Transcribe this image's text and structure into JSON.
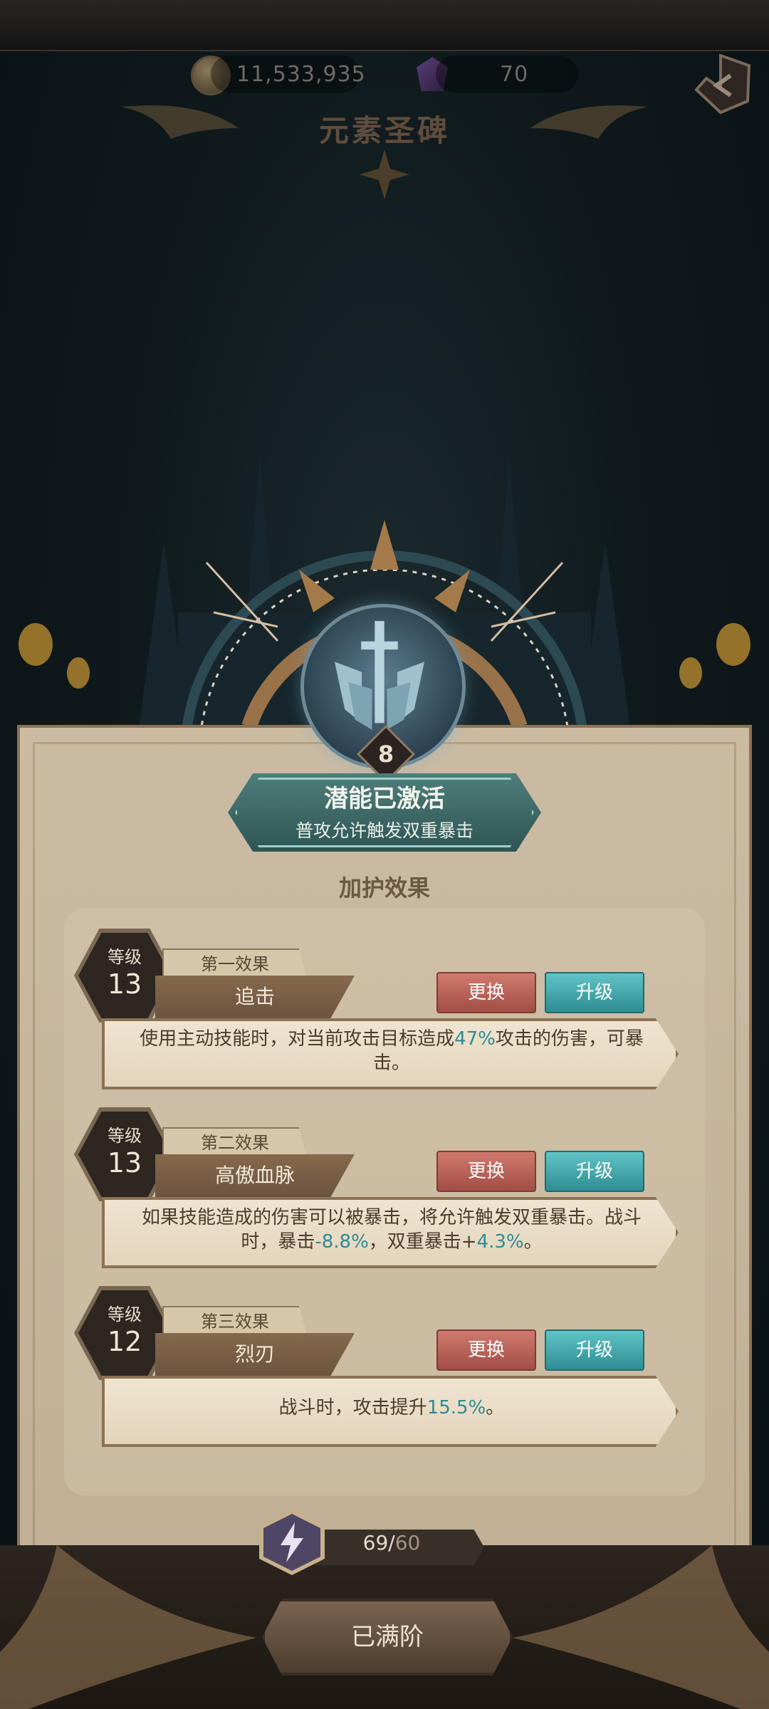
{
  "resources": {
    "gold": "11,533,935",
    "gems": "70"
  },
  "page": {
    "title": "元素圣碑"
  },
  "emblem": {
    "level": "8"
  },
  "activation": {
    "title": "潜能已激活",
    "subtitle": "普攻允许触发双重暴击"
  },
  "section": {
    "title": "加护效果"
  },
  "effects": [
    {
      "level_label": "等级",
      "level": "13",
      "slot": "第一效果",
      "name": "追击",
      "swap_label": "更换",
      "upgrade_label": "升级",
      "desc_parts": [
        "使用主动技能时，对当前攻击目标造成",
        "47%",
        "攻击的伤害，可暴击。"
      ]
    },
    {
      "level_label": "等级",
      "level": "13",
      "slot": "第二效果",
      "name": "高傲血脉",
      "swap_label": "更换",
      "upgrade_label": "升级",
      "desc_parts": [
        "如果技能造成的伤害可以被暴击，将允许触发双重暴击。战斗时，暴击",
        "-8.8%",
        "，双重暴击+",
        "4.3%",
        "。"
      ]
    },
    {
      "level_label": "等级",
      "level": "12",
      "slot": "第三效果",
      "name": "烈刃",
      "swap_label": "更换",
      "upgrade_label": "升级",
      "desc_parts": [
        "战斗时，攻击提升",
        "15.5%",
        "。"
      ]
    }
  ],
  "energy": {
    "current": "69",
    "max": "60"
  },
  "footer": {
    "button_label": "已满阶"
  },
  "icons": {
    "gold": "coin-icon",
    "gems": "gem-icon",
    "back": "back-arrow-icon",
    "emblem": "sword-emblem-icon",
    "energy": "lightning-icon"
  },
  "colors": {
    "highlight": "#2d8a96",
    "swap_button": "#c0655c",
    "upgrade_button": "#45acb0",
    "banner": "#3e6b68"
  }
}
